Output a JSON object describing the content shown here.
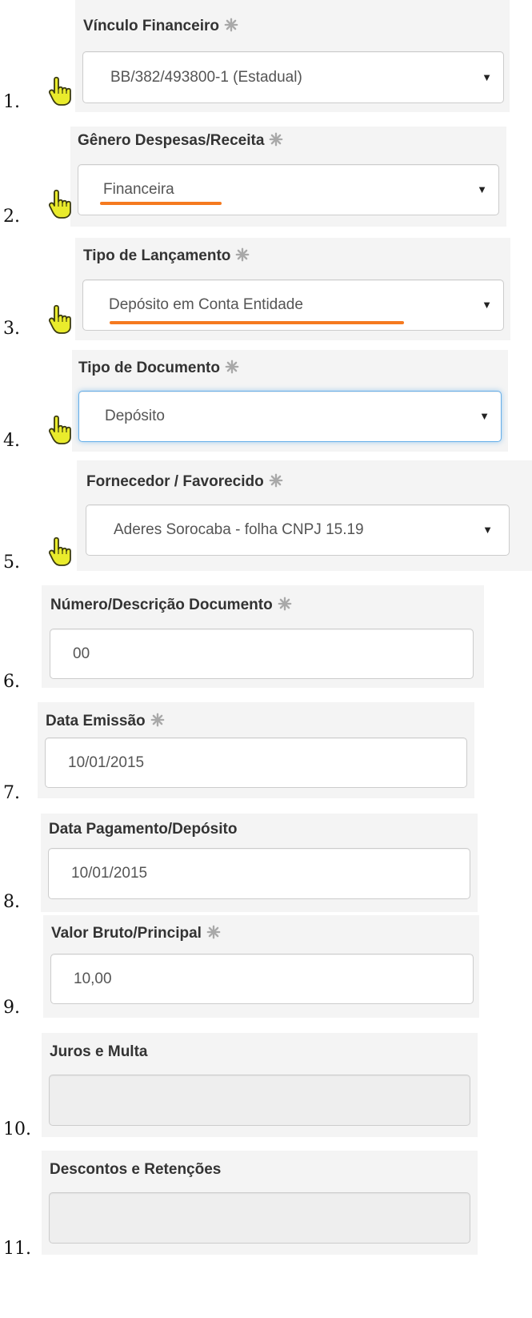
{
  "steps": [
    {
      "number": "1.",
      "label": "Vínculo Financeiro",
      "value": "BB/382/493800-1 (Estadual)",
      "type": "select"
    },
    {
      "number": "2.",
      "label": "Gênero Despesas/Receita",
      "value": "Financeira",
      "type": "select"
    },
    {
      "number": "3.",
      "label": "Tipo de Lançamento",
      "value": "Depósito em Conta Entidade",
      "type": "select"
    },
    {
      "number": "4.",
      "label": "Tipo de Documento",
      "value": "Depósito",
      "type": "select"
    },
    {
      "number": "5.",
      "label": "Fornecedor / Favorecido",
      "value": "Aderes Sorocaba - folha CNPJ 15.19",
      "type": "select"
    },
    {
      "number": "6.",
      "label": "Número/Descrição Documento",
      "value": "00",
      "type": "input"
    },
    {
      "number": "7.",
      "label": "Data Emissão",
      "value": "10/01/2015",
      "type": "input"
    },
    {
      "number": "8.",
      "label": "Data Pagamento/Depósito",
      "value": "10/01/2015",
      "type": "input"
    },
    {
      "number": "9.",
      "label": "Valor Bruto/Principal",
      "value": "10,00",
      "type": "input"
    },
    {
      "number": "10.",
      "label": "Juros e Multa",
      "value": "",
      "type": "input-disabled"
    },
    {
      "number": "11.",
      "label": "Descontos e Retenções",
      "value": "",
      "type": "input-disabled"
    }
  ],
  "icons": {
    "pointer": "pointing-hand-icon",
    "required": "asterisk-icon",
    "dropdown": "caret-down-icon"
  },
  "colors": {
    "highlight": "#f57a20",
    "focus": "#66afe9",
    "required_star": "#aaaaaa",
    "hand": "#e6e629"
  }
}
